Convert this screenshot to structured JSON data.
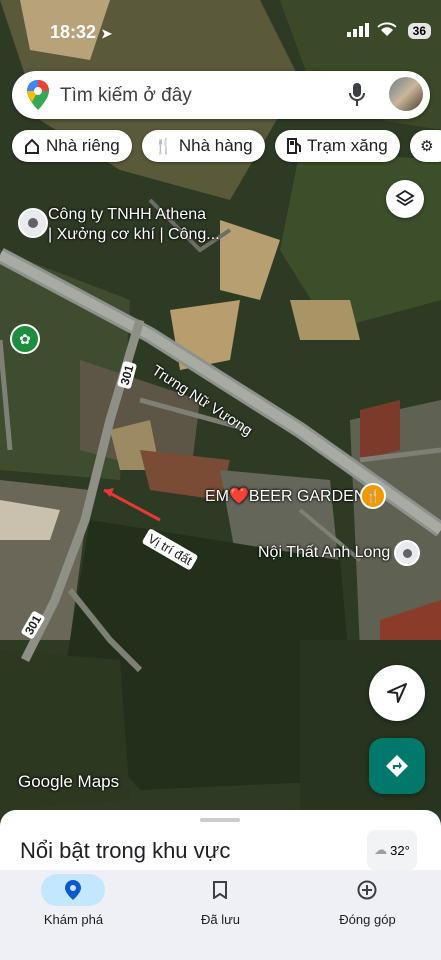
{
  "status_bar": {
    "time": "18:32",
    "battery": "36"
  },
  "search": {
    "placeholder": "Tìm kiếm ở đây"
  },
  "chips": [
    {
      "label": "Nhà riêng",
      "icon": "home-icon"
    },
    {
      "label": "Nhà hàng",
      "icon": "restaurant-icon"
    },
    {
      "label": "Trạm xăng",
      "icon": "gas-station-icon"
    }
  ],
  "map": {
    "places": [
      {
        "line1": "Công ty TNHH Athena",
        "line2": "| Xưởng cơ khí | Công..."
      },
      {
        "name": "EM❤️BEER GARDEN"
      },
      {
        "name": "Nội Thất Anh Long"
      }
    ],
    "roads": {
      "main": "Trưng Nữ Vương",
      "route_top": "301",
      "route_bottom": "301"
    },
    "annotation": "Vị trí đất",
    "attribution": "Google Maps"
  },
  "sheet": {
    "title": "Nổi bật trong khu vực",
    "temperature": "32°"
  },
  "nav": [
    {
      "label": "Khám phá",
      "icon": "explore-pin-icon",
      "active": true
    },
    {
      "label": "Đã lưu",
      "icon": "bookmark-icon",
      "active": false
    },
    {
      "label": "Đóng góp",
      "icon": "add-circle-icon",
      "active": false
    }
  ],
  "colors": {
    "accent": "#1a73e8",
    "directions_fab": "#00796b",
    "nav_active": "#c2e7ff",
    "annotation_arrow": "#e53935"
  }
}
